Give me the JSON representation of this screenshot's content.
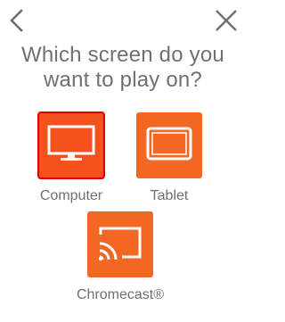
{
  "header": {
    "back_icon": "chevron-left-icon",
    "close_icon": "close-icon"
  },
  "title": "Which screen do you want to play on?",
  "accent_color": "#f26722",
  "selected_outline_color": "#e10000",
  "devices": [
    {
      "label": "Computer",
      "icon": "monitor-icon",
      "selected": true
    },
    {
      "label": "Tablet",
      "icon": "tablet-icon",
      "selected": false
    },
    {
      "label": "Chromecast®",
      "icon": "chromecast-icon",
      "selected": false
    }
  ]
}
